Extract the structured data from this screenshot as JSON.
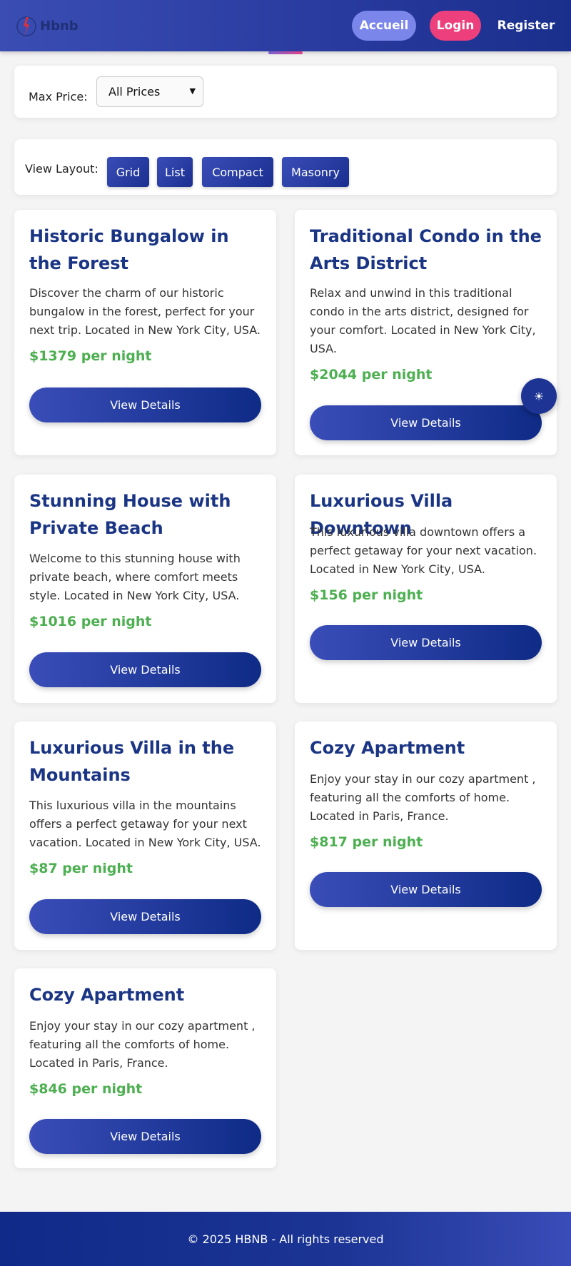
{
  "header": {
    "logo_text": "Hbnb",
    "nav": {
      "accueil": "Accueil",
      "login": "Login",
      "register": "Register"
    },
    "colors": {
      "accueil_bg": "#7a86ea",
      "login_bg": "#ec3f7c"
    }
  },
  "filters": {
    "max_price_label": "Max Price:",
    "max_price_value": "All Prices"
  },
  "layout": {
    "label": "View Layout:",
    "buttons": [
      "Grid",
      "List",
      "Compact",
      "Masonry"
    ]
  },
  "places": [
    {
      "title": "Historic Bungalow in the Forest",
      "description": "Discover the charm of our historic bungalow in the forest, perfect for your next trip. Located in New York City, USA.",
      "price": "$1379 per night",
      "button": "View Details"
    },
    {
      "title": "Traditional Condo in the Arts District",
      "description": "Relax and unwind in this traditional condo in the arts district, designed for your comfort. Located in New York City, USA.",
      "price": "$2044 per night",
      "button": "View Details"
    },
    {
      "title": "Stunning House with Private Beach",
      "description": "Welcome to this stunning house with private beach, where comfort meets style. Located in New York City, USA.",
      "price": "$1016 per night",
      "button": "View Details"
    },
    {
      "title": "Luxurious Villa Downtown",
      "description": "This luxurious villa downtown offers a perfect getaway for your next vacation. Located in New York City, USA.",
      "price": "$156 per night",
      "button": "View Details"
    },
    {
      "title": "Luxurious Villa in the Mountains",
      "description": "This luxurious villa in the mountains offers a perfect getaway for your next vacation. Located in New York City, USA.",
      "price": "$87 per night",
      "button": "View Details"
    },
    {
      "title": "Cozy Apartment",
      "description": "Enjoy your stay in our cozy apartment , featuring all the comforts of home. Located in Paris, France.",
      "price": "$817 per night",
      "button": "View Details"
    },
    {
      "title": "Cozy Apartment",
      "description": "Enjoy your stay in our cozy apartment , featuring all the comforts of home. Located in Paris, France.",
      "price": "$846 per night",
      "button": "View Details"
    }
  ],
  "theme_toggle": {
    "icon": "sun-icon",
    "glyph": "☀"
  },
  "footer": {
    "text": "© 2025 HBNB - All rights reserved"
  },
  "colors": {
    "accent": "#1b3585",
    "price": "#4caf50",
    "background": "#f4f4f4"
  }
}
